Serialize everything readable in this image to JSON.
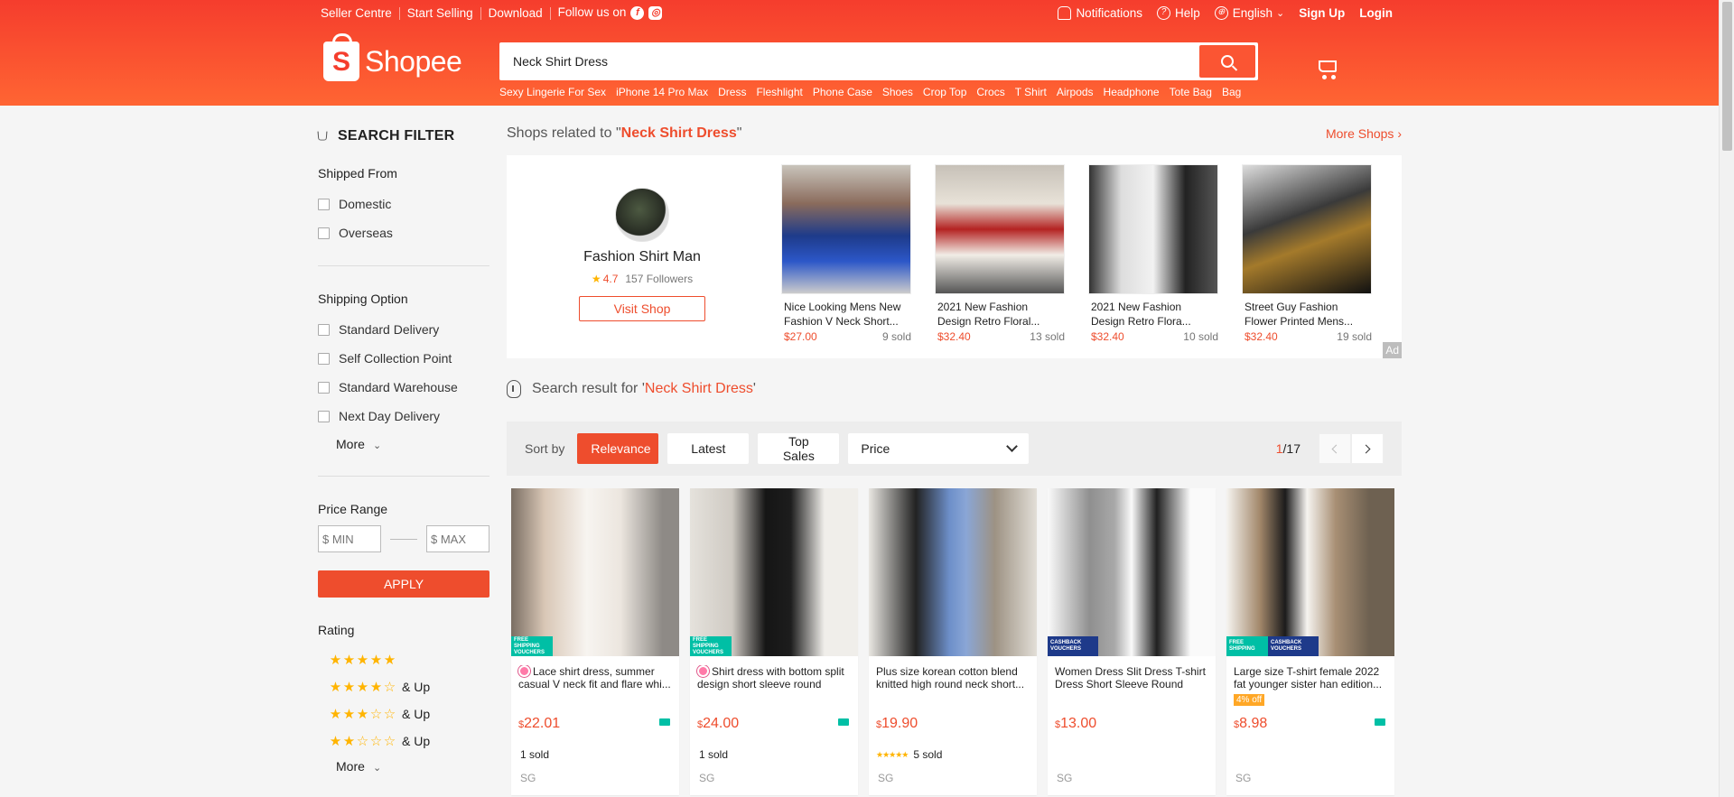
{
  "topnav": {
    "seller_centre": "Seller Centre",
    "start_selling": "Start Selling",
    "download": "Download",
    "follow_us": "Follow us on",
    "notifications": "Notifications",
    "help": "Help",
    "language": "English",
    "sign_up": "Sign Up",
    "login": "Login"
  },
  "brand": {
    "name": "Shopee",
    "color": "#ee4d2d"
  },
  "search": {
    "value": "Neck Shirt Dress",
    "hints": [
      "Sexy Lingerie For Sex",
      "iPhone 14 Pro Max",
      "Dress",
      "Fleshlight",
      "Phone Case",
      "Shoes",
      "Crop Top",
      "Crocs",
      "T Shirt",
      "Airpods",
      "Headphone",
      "Tote Bag",
      "Bag"
    ]
  },
  "filter": {
    "title": "SEARCH FILTER",
    "shipped_from": {
      "title": "Shipped From",
      "options": [
        "Domestic",
        "Overseas"
      ]
    },
    "shipping_option": {
      "title": "Shipping Option",
      "options": [
        "Standard Delivery",
        "Self Collection Point",
        "Standard Warehouse",
        "Next Day Delivery"
      ],
      "more": "More"
    },
    "price_range": {
      "title": "Price Range",
      "min_placeholder": "$ MIN",
      "max_placeholder": "$ MAX",
      "apply": "APPLY"
    },
    "rating": {
      "title": "Rating",
      "levels": [
        5,
        4,
        3,
        2
      ],
      "and_up": "& Up",
      "more": "More"
    }
  },
  "shops": {
    "prefix": "Shops related to \"",
    "query": "Neck Shirt Dress",
    "suffix": "\"",
    "more_shops": "More Shops",
    "shop": {
      "name": "Fashion Shirt Man",
      "rating": "4.7",
      "followers": "157 Followers",
      "visit": "Visit Shop"
    },
    "products": [
      {
        "title": "Nice Looking Mens New Fashion V Neck Short...",
        "price": "$27.00",
        "sold": "9 sold"
      },
      {
        "title": "2021 New Fashion Design Retro Floral...",
        "price": "$32.40",
        "sold": "13 sold"
      },
      {
        "title": "2021 New Fashion Design Retro Flora...",
        "price": "$32.40",
        "sold": "10 sold"
      },
      {
        "title": "Street Guy Fashion Flower Printed Mens...",
        "price": "$32.40",
        "sold": "19 sold"
      }
    ],
    "ad": "Ad"
  },
  "results": {
    "prefix": "Search result for '",
    "query": "Neck Shirt Dress",
    "suffix": "'"
  },
  "sort": {
    "label": "Sort by",
    "relevance": "Relevance",
    "latest": "Latest",
    "top_sales": "Top Sales",
    "price": "Price",
    "page_current": "1",
    "page_total": "/17"
  },
  "products": [
    {
      "title": "Lace shirt dress, summer casual V neck fit and flare whi...",
      "currency": "$",
      "price": "22.01",
      "sold": "1 sold",
      "loc": "SG",
      "badge": "FREE SHIPPING VOUCHERS"
    },
    {
      "title": "Shirt dress with bottom split design short sleeve round nec...",
      "currency": "$",
      "price": "24.00",
      "sold": "1 sold",
      "loc": "SG",
      "badge": "FREE SHIPPING VOUCHERS"
    },
    {
      "title": "Plus size korean cotton blend knitted high round neck short...",
      "currency": "$",
      "price": "19.90",
      "sold": "5 sold",
      "loc": "SG"
    },
    {
      "title": "Women Dress Slit Dress T-shirt Dress Short Sleeve Round Nec...",
      "currency": "$",
      "price": "13.00",
      "loc": "SG",
      "badge": "CASHBACK VOUCHERS"
    },
    {
      "title": "Large size T-shirt female 2022 fat younger sister han edition...",
      "currency": "$",
      "price": "8.98",
      "discount": "4% off",
      "loc": "SG",
      "badge": "FREE SHIPPING",
      "badge2": "CASHBACK VOUCHERS"
    }
  ]
}
